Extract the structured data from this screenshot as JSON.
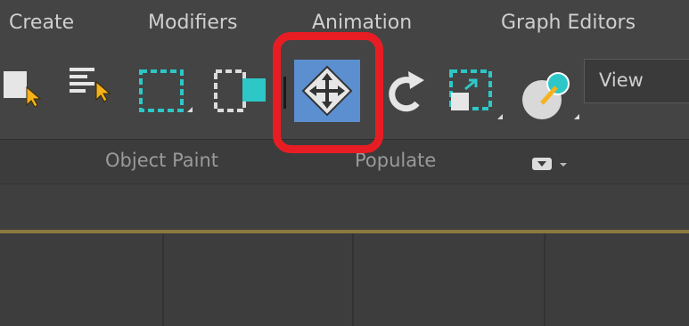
{
  "menu": {
    "create": "Create",
    "modifiers": "Modifiers",
    "animation": "Animation",
    "graph_editors": "Graph Editors"
  },
  "toolbar": {
    "items": [
      {
        "icon": "select-object-icon"
      },
      {
        "icon": "select-by-name-icon"
      },
      {
        "icon": "rectangular-selection-region-icon"
      },
      {
        "icon": "window-crossing-icon"
      },
      {
        "icon": "select-and-move-icon",
        "active": true
      },
      {
        "icon": "select-and-rotate-icon"
      },
      {
        "icon": "select-and-scale-icon"
      },
      {
        "icon": "place-icon"
      }
    ],
    "reference_coordinate_system": "View"
  },
  "ribbon": {
    "object_paint": "Object Paint",
    "populate": "Populate"
  },
  "colors": {
    "accent_blue": "#5b8fd0",
    "highlight_red": "#e81d24",
    "teal": "#2ec7c7",
    "cursor_yellow": "#f6b21b"
  }
}
